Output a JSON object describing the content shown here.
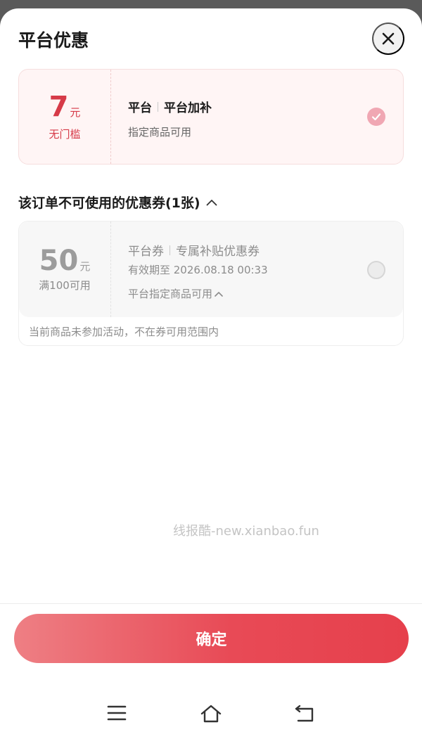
{
  "sheet": {
    "title": "平台优惠",
    "close_icon": "close-icon"
  },
  "active_coupon": {
    "amount": "7",
    "unit": "元",
    "condition": "无门槛",
    "tag": "平台",
    "name": "平台加补",
    "scope": "指定商品可用",
    "selected": true
  },
  "unusable_section": {
    "title": "该订单不可使用的优惠券(1张)",
    "expanded": true
  },
  "disabled_coupon": {
    "amount": "50",
    "unit": "元",
    "condition": "满100可用",
    "tag": "平台券",
    "name": "专属补贴优惠券",
    "expiry": "有效期至 2026.08.18 00:33",
    "scope": "平台指定商品可用",
    "reason": "当前商品未参加活动，不在券可用范围内"
  },
  "watermark": "线报酷-new.xianbao.fun",
  "confirm_label": "确定",
  "colors": {
    "accent": "#d63a48",
    "button_start": "#ee7f84",
    "button_end": "#e6404c"
  },
  "nav": [
    "menu-icon",
    "home-icon",
    "back-icon"
  ]
}
